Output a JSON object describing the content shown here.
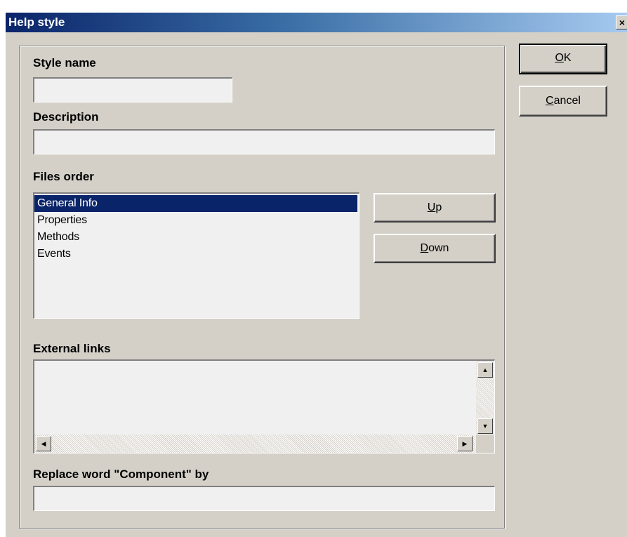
{
  "window": {
    "title": "Help style",
    "close_glyph": "×"
  },
  "buttons": {
    "ok_label": "OK",
    "ok_mnemonic": "O",
    "cancel_label": "Cancel",
    "cancel_mnemonic": "C",
    "up_label": "Up",
    "up_mnemonic": "U",
    "down_label": "Down",
    "down_mnemonic": "D"
  },
  "form": {
    "style_name_label": "Style name",
    "style_name_value": "",
    "description_label": "Description",
    "description_value": "",
    "files_order_label": "Files order",
    "files_order_items": [
      "General Info",
      "Properties",
      "Methods",
      "Events"
    ],
    "files_order_selected": "General Info",
    "external_links_label": "External links",
    "external_links_value": "",
    "replace_label": "Replace word \"Component\" by",
    "replace_value": ""
  },
  "colors": {
    "selection": "#0a246a",
    "face": "#d4d0c8",
    "field": "#f0f0f0"
  },
  "icons": {
    "scroll_up": "arrow-up-icon",
    "scroll_down": "arrow-down-icon",
    "scroll_left": "arrow-left-icon",
    "scroll_right": "arrow-right-icon"
  }
}
